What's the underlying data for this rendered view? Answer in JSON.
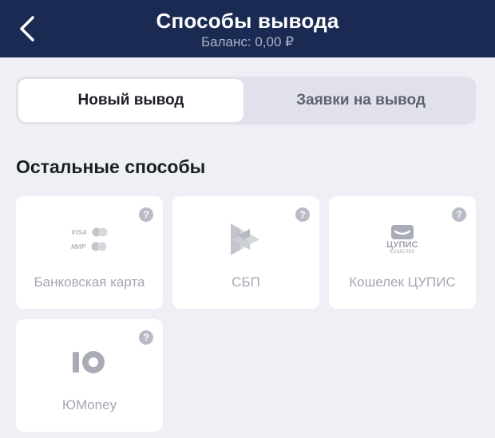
{
  "header": {
    "title": "Способы вывода",
    "balance": "Баланс: 0,00 ₽"
  },
  "tabs": [
    {
      "label": "Новый вывод",
      "active": true
    },
    {
      "label": "Заявки на вывод",
      "active": false
    }
  ],
  "section": {
    "title": "Остальные способы"
  },
  "methods": [
    {
      "label": "Банковская карта",
      "icon": "bank-card-icon",
      "logo_lines": [
        "VISA",
        "МИР"
      ],
      "help": "?"
    },
    {
      "label": "СБП",
      "icon": "sbp-icon",
      "help": "?"
    },
    {
      "label": "Кошелек ЦУПИС",
      "icon": "cupis-wallet-icon",
      "logo_word": "ЦУПИС",
      "logo_sub": "КОШЕЛЕК",
      "help": "?"
    },
    {
      "label": "ЮMoney",
      "icon": "yumoney-icon",
      "help": "?"
    }
  ],
  "colors": {
    "header_bg": "#1b2a52",
    "page_bg": "#eef0f5",
    "card_bg": "#ffffff",
    "muted_text": "#a4a7b2"
  }
}
